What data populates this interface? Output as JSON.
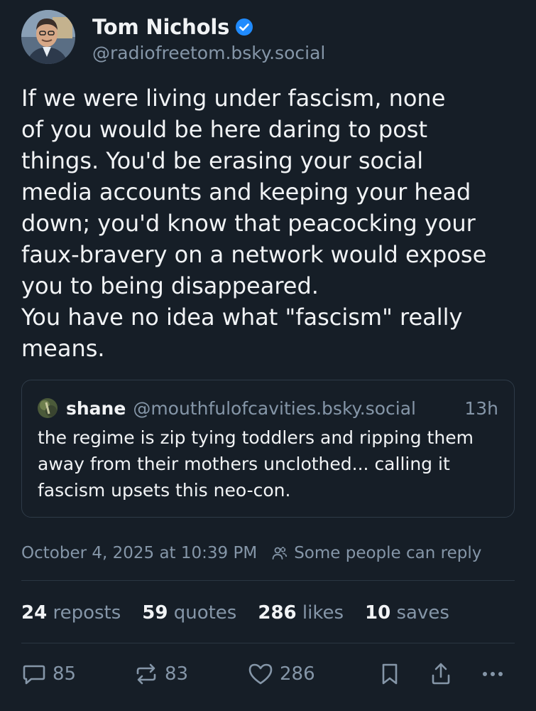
{
  "author": {
    "display_name": "Tom Nichols",
    "handle": "@radiofreetom.bsky.social",
    "verified": true
  },
  "post": {
    "text": "If we were living under fascism, none\nof you would be here daring to post\nthings. You'd be erasing your social\nmedia accounts and keeping your head\ndown; you'd know that peacocking your\nfaux-bravery on a network would expose\nyou to being disappeared.\nYou have no idea what \"fascism\" really\nmeans."
  },
  "quote": {
    "name": "shane",
    "handle": "@mouthfulofcavities.bsky.social",
    "time": "13h",
    "text": "the regime is zip tying toddlers and ripping them\naway from their mothers unclothed... calling it\nfascism upsets this neo-con."
  },
  "meta": {
    "timestamp": "October 4, 2025 at 10:39 PM",
    "reply_setting": "Some people can reply"
  },
  "stats": {
    "reposts_count": "24",
    "reposts_label": "reposts",
    "quotes_count": "59",
    "quotes_label": "quotes",
    "likes_count": "286",
    "likes_label": "likes",
    "saves_count": "10",
    "saves_label": "saves"
  },
  "actions": {
    "reply_count": "85",
    "repost_count": "83",
    "like_count": "286"
  },
  "icons": {
    "verified": "verified-check-icon",
    "reply": "speech-bubble-icon",
    "repost": "repost-arrows-icon",
    "like": "heart-icon",
    "bookmark": "bookmark-icon",
    "share": "share-icon",
    "more": "ellipsis-icon",
    "people": "people-icon"
  },
  "colors": {
    "background": "#161e27",
    "text": "#f1f3f5",
    "muted": "#8596a8",
    "verified": "#208bfe"
  }
}
